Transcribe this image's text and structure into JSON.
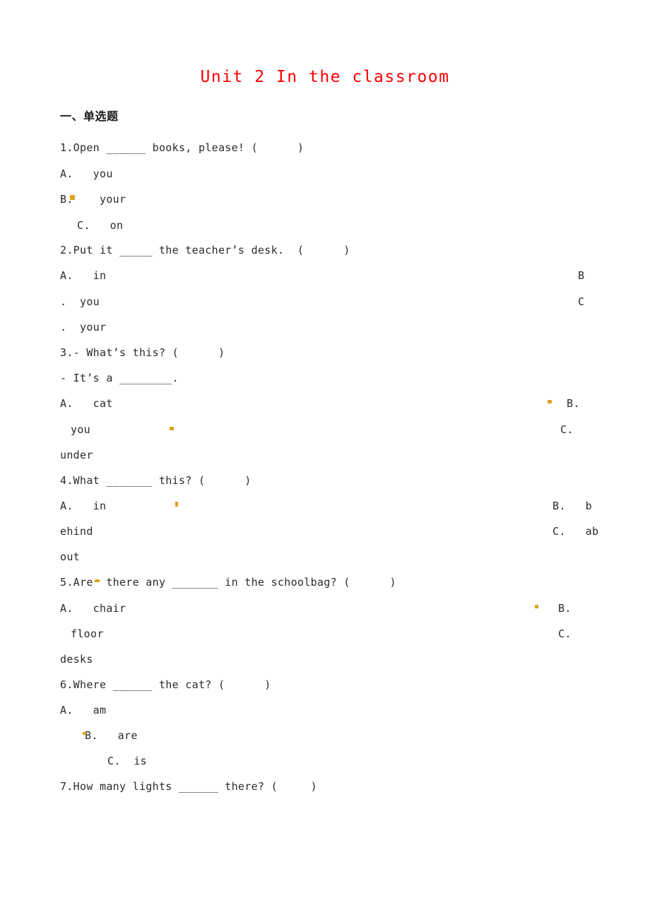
{
  "document": {
    "title": "Unit 2 In the classroom",
    "title_color": "#ff0000",
    "section_heading": "一、单选题",
    "body_color": "#2b2b2b"
  },
  "lines": [
    {
      "id": "q1_stem",
      "text": "1.Open ______ books, please! (      )"
    },
    {
      "id": "q1_a",
      "text": "A.   you"
    },
    {
      "id": "q1_b",
      "text": "B.    your"
    },
    {
      "id": "q1_c",
      "text": "C.   on"
    },
    {
      "id": "q2_stem",
      "text": "2.Put it _____ the teacher’s desk.  (      )"
    },
    {
      "id": "q2_a",
      "text": "A.   in"
    },
    {
      "id": "q2_b_tail",
      "text": ".  you"
    },
    {
      "id": "q2_c_tail",
      "text": ".  your"
    },
    {
      "id": "q2_b_mark",
      "text": "B"
    },
    {
      "id": "q2_c_mark",
      "text": "C"
    },
    {
      "id": "q3_stem",
      "text": "3.- What’s this? (      )"
    },
    {
      "id": "q3_stem2",
      "text": "- It’s a ________."
    },
    {
      "id": "q3_a",
      "text": "A.   cat"
    },
    {
      "id": "q3_b_tail",
      "text": "you"
    },
    {
      "id": "q3_c_tail",
      "text": "under"
    },
    {
      "id": "q3_b_mark",
      "text": "B."
    },
    {
      "id": "q3_c_mark",
      "text": "C."
    },
    {
      "id": "q4_stem",
      "text": "4.What _______ this? (      )"
    },
    {
      "id": "q4_a",
      "text": "A.   in"
    },
    {
      "id": "q4_b_tail",
      "text": "ehind"
    },
    {
      "id": "q4_c_tail",
      "text": "out"
    },
    {
      "id": "q4_b_mark",
      "text": "B.   b"
    },
    {
      "id": "q4_c_mark",
      "text": "C.   ab"
    },
    {
      "id": "q5_stem",
      "text": "5.Are  there any _______ in the schoolbag? (      )"
    },
    {
      "id": "q5_a",
      "text": "A.   chair"
    },
    {
      "id": "q5_b_tail",
      "text": "floor"
    },
    {
      "id": "q5_c_tail",
      "text": "desks"
    },
    {
      "id": "q5_b_mark",
      "text": "B."
    },
    {
      "id": "q5_c_mark",
      "text": "C."
    },
    {
      "id": "q6_stem",
      "text": "6.Where ______ the cat? (      )"
    },
    {
      "id": "q6_a",
      "text": "A.   am"
    },
    {
      "id": "q6_b",
      "text": "B.   are"
    },
    {
      "id": "q6_c",
      "text": "C.  is"
    },
    {
      "id": "q7_stem",
      "text": "7.How many lights ______ there? (     )"
    }
  ]
}
